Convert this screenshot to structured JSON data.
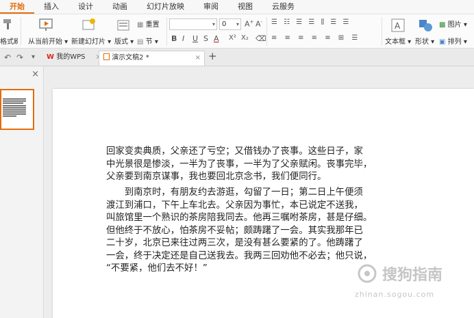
{
  "tabs": [
    "开始",
    "插入",
    "设计",
    "动画",
    "幻灯片放映",
    "审阅",
    "视图",
    "云服务"
  ],
  "ribbon": {
    "format_painter": "格式刷",
    "from_current": "从当前开始",
    "new_slide": "新建幻灯片",
    "layout": "版式",
    "reset": "重置",
    "section": "节",
    "font_size": "0",
    "textbox": "文本框",
    "shape": "形状",
    "picture": "图片",
    "arrange": "排列",
    "font_buttons": [
      "B",
      "I",
      "U",
      "S",
      "A",
      "X²",
      "X₂"
    ]
  },
  "doc_tabs": {
    "wps": "我的WPS",
    "current": "演示文稿2 *"
  },
  "slide_text": {
    "p1": [
      "回家变卖典质，父亲还了亏空；又借钱办了丧事。这些日子，家",
      "中光景很是惨淡，一半为了丧事，一半为了父亲赋闲。丧事完毕，",
      "父亲要到南京谋事，我也要回北京念书，我们便同行。"
    ],
    "p2": [
      "　　到南京时，有朋友约去游逛，勾留了一日；第二日上午便须",
      "渡江到浦口，下午上车北去。父亲因为事忙，本已说定不送我，",
      "叫旅馆里一个熟识的茶房陪我同去。他再三嘱咐茶房，甚是仔细。",
      "但他终于不放心，怕茶房不妥帖；颇踌躇了一会。其实我那年已",
      "二十岁，北京已来往过两三次，是没有甚么要紧的了。他踌躇了",
      "一会，终于决定还是自己送我去。我两三回劝他不必去；他只说，",
      "“不要紧，他们去不好！”"
    ]
  },
  "watermark": {
    "brand": "搜狗指南",
    "url": "zhinan.sogou.com"
  },
  "colors": {
    "accent": "#e46c0a",
    "wps_red": "#d9261c"
  }
}
